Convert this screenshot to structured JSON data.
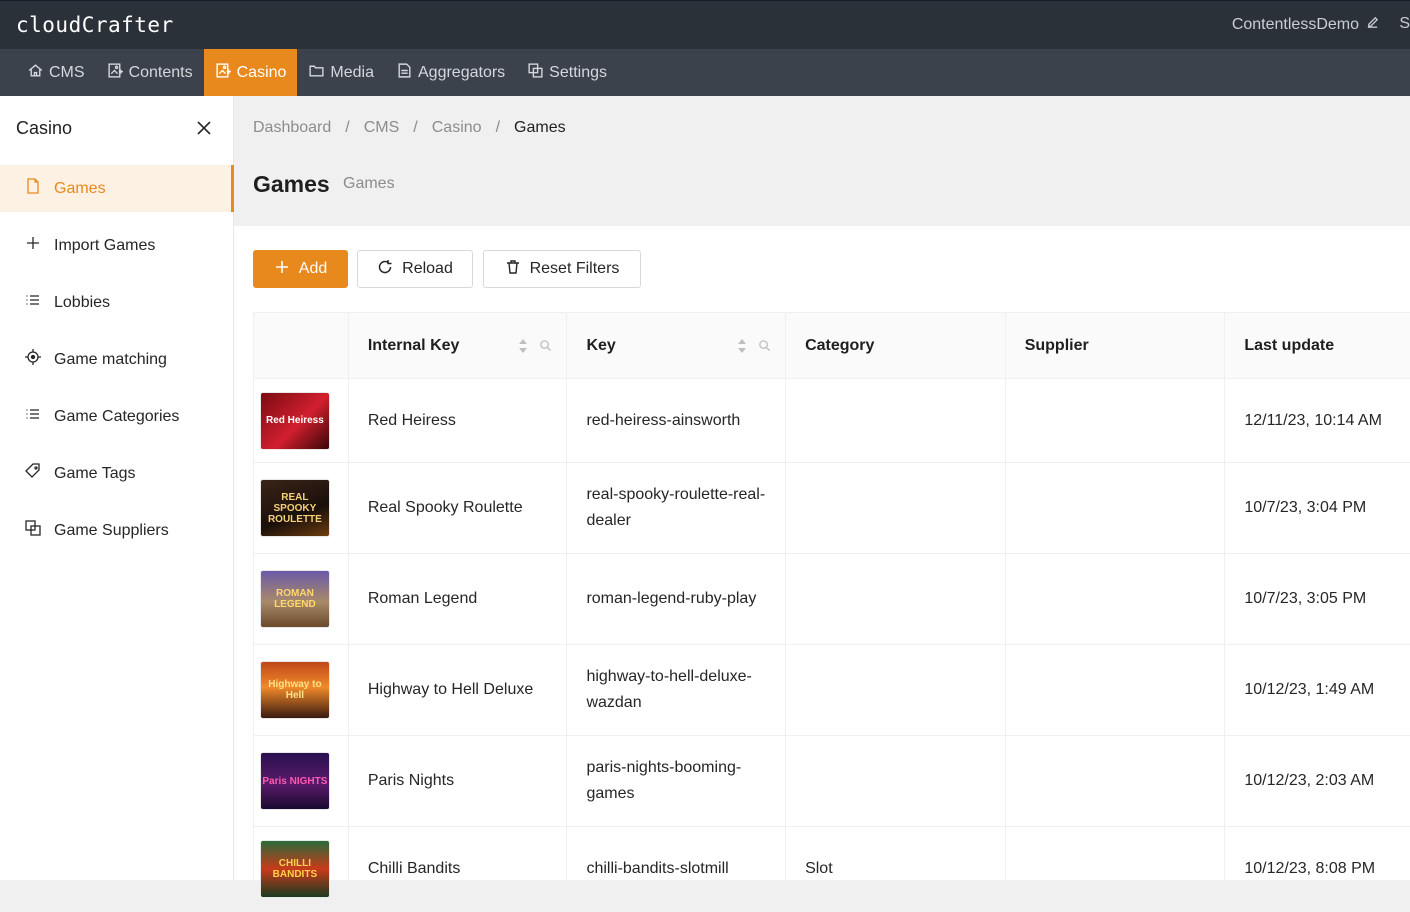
{
  "app": {
    "logo": "cloudCrafter",
    "tenant": "ContentlessDemo",
    "tenant_extra": "S"
  },
  "nav": [
    {
      "label": "CMS",
      "icon": "home-icon"
    },
    {
      "label": "Contents",
      "icon": "file-image-icon"
    },
    {
      "label": "Casino",
      "icon": "file-image-icon"
    },
    {
      "label": "Media",
      "icon": "folder-icon"
    },
    {
      "label": "Aggregators",
      "icon": "document-icon"
    },
    {
      "label": "Settings",
      "icon": "layers-icon"
    }
  ],
  "sidebar": {
    "title": "Casino",
    "items": [
      {
        "label": "Games",
        "icon": "file-icon"
      },
      {
        "label": "Import Games",
        "icon": "plus-icon"
      },
      {
        "label": "Lobbies",
        "icon": "list-icon"
      },
      {
        "label": "Game matching",
        "icon": "crosshair-icon"
      },
      {
        "label": "Game Categories",
        "icon": "list-icon"
      },
      {
        "label": "Game Tags",
        "icon": "tag-icon"
      },
      {
        "label": "Game Suppliers",
        "icon": "layers-icon"
      }
    ]
  },
  "breadcrumb": [
    "Dashboard",
    "/",
    "CMS",
    "/",
    "Casino",
    "/",
    "Games"
  ],
  "page": {
    "title": "Games",
    "subtitle": "Games"
  },
  "toolbar": {
    "add": "Add",
    "reload": "Reload",
    "reset": "Reset Filters"
  },
  "table": {
    "columns": [
      "Internal Key",
      "Key",
      "Category",
      "Supplier",
      "Last update"
    ],
    "rows": [
      {
        "thumb": "Red Heiress",
        "internal_key": "Red Heiress",
        "key": "red-heiress-ainsworth",
        "category": "",
        "supplier": "",
        "updated": "12/11/23, 10:14 AM"
      },
      {
        "thumb": "REAL SPOOKY ROULETTE",
        "internal_key": "Real Spooky Roulette",
        "key": "real-spooky-roulette-real-dealer",
        "category": "",
        "supplier": "",
        "updated": "10/7/23, 3:04 PM"
      },
      {
        "thumb": "ROMAN LEGEND",
        "internal_key": "Roman Legend",
        "key": "roman-legend-ruby-play",
        "category": "",
        "supplier": "",
        "updated": "10/7/23, 3:05 PM"
      },
      {
        "thumb": "Highway to Hell",
        "internal_key": "Highway to Hell Deluxe",
        "key": "highway-to-hell-deluxe-wazdan",
        "category": "",
        "supplier": "",
        "updated": "10/12/23, 1:49 AM"
      },
      {
        "thumb": "Paris NIGHTS",
        "internal_key": "Paris Nights",
        "key": "paris-nights-booming-games",
        "category": "",
        "supplier": "",
        "updated": "10/12/23, 2:03 AM"
      },
      {
        "thumb": "CHILLI BANDITS",
        "internal_key": "Chilli Bandits",
        "key": "chilli-bandits-slotmill",
        "category": "Slot",
        "supplier": "",
        "updated": "10/12/23, 8:08 PM"
      }
    ]
  },
  "colors": {
    "accent": "#e8891d",
    "topbar": "#2b3138",
    "navbar": "#3b424b"
  }
}
